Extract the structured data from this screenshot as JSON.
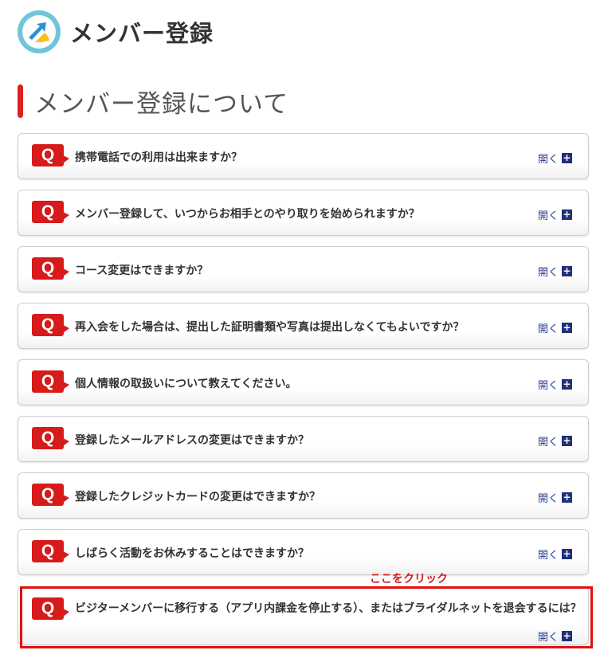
{
  "header": {
    "title": "メンバー登録"
  },
  "section": {
    "title": "メンバー登録について"
  },
  "faq": {
    "open_label": "開く",
    "items": [
      {
        "q": "Q",
        "text": "携帯電話での利用は出来ますか？"
      },
      {
        "q": "Q",
        "text": "メンバー登録して、いつからお相手とのやり取りを始められますか？"
      },
      {
        "q": "Q",
        "text": "コース変更はできますか？"
      },
      {
        "q": "Q",
        "text": "再入会をした場合は、提出した証明書類や写真は提出しなくてもよいですか？"
      },
      {
        "q": "Q",
        "text": "個人情報の取扱いについて教えてください。"
      },
      {
        "q": "Q",
        "text": "登録したメールアドレスの変更はできますか？"
      },
      {
        "q": "Q",
        "text": "登録したクレジットカードの変更はできますか？"
      },
      {
        "q": "Q",
        "text": "しばらく活動をお休みすることはできますか？"
      },
      {
        "q": "Q",
        "text": "ビジターメンバーに移行する（アプリ内課金を停止する）、またはブライダルネットを退会するには？"
      }
    ]
  },
  "annotation": {
    "label": "ここをクリック",
    "color": "#e01010"
  },
  "colors": {
    "accent_red": "#d71a1a",
    "link_blue": "#2a3b8f",
    "logo_teal": "#6ec6d8"
  }
}
